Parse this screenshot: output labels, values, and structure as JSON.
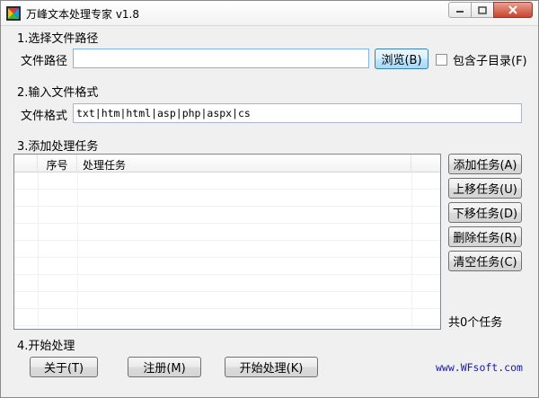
{
  "window": {
    "title": "万峰文本处理专家 v1.8",
    "icon": "app-icon"
  },
  "section1": {
    "label": "1.选择文件路径",
    "path_label": "文件路径",
    "path_value": "",
    "browse_button": "浏览(B)",
    "include_subdirs_label": "包含子目录(F)",
    "include_subdirs_checked": false
  },
  "section2": {
    "label": "2.输入文件格式",
    "format_label": "文件格式",
    "format_value": "txt|htm|html|asp|php|aspx|cs"
  },
  "section3": {
    "label": "3.添加处理任务",
    "columns": [
      "序号",
      "处理任务"
    ],
    "rows": [],
    "buttons": {
      "add": "添加任务(A)",
      "move_up": "上移任务(U)",
      "move_down": "下移任务(D)",
      "delete": "删除任务(R)",
      "clear": "清空任务(C)"
    },
    "count_text": "共0个任务"
  },
  "section4": {
    "label": "4.开始处理",
    "about_button": "关于(T)",
    "register_button": "注册(M)",
    "start_button": "开始处理(K)",
    "website": "www.WFsoft.com"
  },
  "colors": {
    "website_link": "#1a1aa6",
    "close_button": "#c9432d"
  }
}
